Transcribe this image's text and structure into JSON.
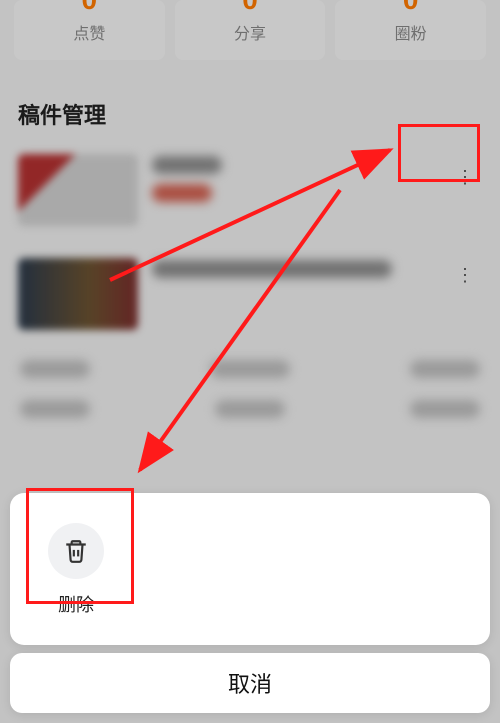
{
  "stats": {
    "like": "点赞",
    "share": "分享",
    "fans": "圈粉"
  },
  "sectionTitle": "稿件管理",
  "sheet": {
    "deleteLabel": "删除",
    "cancelLabel": "取消"
  },
  "icons": {
    "more": "more-vert-icon",
    "trash": "trash-icon"
  }
}
